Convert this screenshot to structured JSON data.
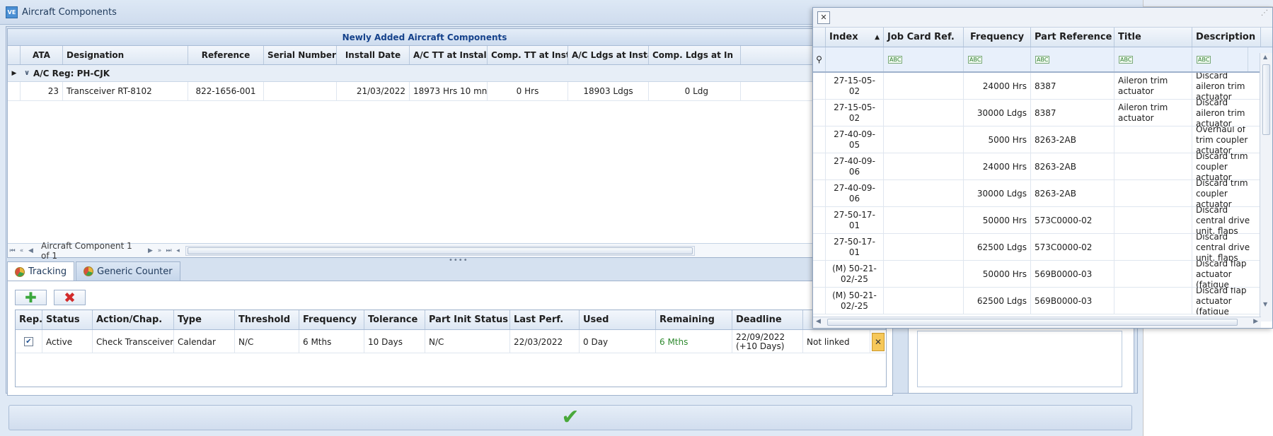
{
  "window": {
    "title": "Aircraft Components",
    "icon": "app-logo-icon"
  },
  "top_grid": {
    "band_title": "Newly Added Aircraft Components",
    "columns": [
      "ATA",
      "Designation",
      "Reference",
      "Serial Number",
      "Install Date",
      "A/C TT at Install",
      "Comp. TT at Install",
      "A/C Ldgs at Install",
      "Comp. Ldgs at In"
    ],
    "group_label": "A/C Reg: PH-CJK",
    "rows": [
      {
        "ata": "23",
        "designation": "Transceiver RT-8102",
        "reference": "822-1656-001",
        "serial": "",
        "install_date": "21/03/2022",
        "ac_tt": "18973 Hrs 10 mn",
        "comp_tt": "0 Hrs",
        "ac_ldgs": "18903 Ldgs",
        "comp_ldgs": "0 Ldg"
      }
    ],
    "nav_text": "Aircraft Component 1 of 1"
  },
  "tabs": [
    {
      "label": "Tracking",
      "icon": "pie-chart-icon",
      "active": true
    },
    {
      "label": "Generic Counter",
      "icon": "pie-chart-icon",
      "active": false
    }
  ],
  "tracking": {
    "columns": [
      "Rep.",
      "Status",
      "Action/Chap.",
      "Type",
      "Threshold",
      "Frequency",
      "Tolerance",
      "Part Init Status",
      "Last Perf.",
      "Used",
      "Remaining",
      "Deadline"
    ],
    "rows": [
      {
        "rep": true,
        "status": "Active",
        "action": "Check Transceiver",
        "type": "Calendar",
        "threshold": "N/C",
        "frequency": "6 Mths",
        "tolerance": "10 Days",
        "part_init": "N/C",
        "last_perf": "22/03/2022",
        "used": "0 Day",
        "remaining": "6 Mths",
        "deadline": "22/09/2022 (+10 Days)",
        "link": "Not linked"
      }
    ]
  },
  "colors": {
    "accent": "#15428b",
    "remaining_green": "#2f8a2f",
    "check_green": "#49a83a",
    "delete_red": "#d22b2b"
  },
  "popup": {
    "columns": [
      "Index",
      "Job Card Ref.",
      "Frequency",
      "Part Reference",
      "Title",
      "Description"
    ],
    "rows": [
      {
        "index": "27-15-05-02",
        "job": "",
        "freq": "24000 Hrs",
        "part": "8387",
        "title": "Aileron trim actuator",
        "desc": "Discard aileron trim actuator"
      },
      {
        "index": "27-15-05-02",
        "job": "",
        "freq": "30000 Ldgs",
        "part": "8387",
        "title": "Aileron trim actuator",
        "desc": "Discard aileron trim actuator"
      },
      {
        "index": "27-40-09-05",
        "job": "",
        "freq": "5000 Hrs",
        "part": "8263-2AB",
        "title": "",
        "desc": "Overhaul of trim coupler actuator"
      },
      {
        "index": "27-40-09-06",
        "job": "",
        "freq": "24000 Hrs",
        "part": "8263-2AB",
        "title": "",
        "desc": "Discard trim coupler actuator"
      },
      {
        "index": "27-40-09-06",
        "job": "",
        "freq": "30000 Ldgs",
        "part": "8263-2AB",
        "title": "",
        "desc": "Discard trim coupler actuator"
      },
      {
        "index": "27-50-17-01",
        "job": "",
        "freq": "50000 Hrs",
        "part": "573C0000-02",
        "title": "",
        "desc": "Discard central drive unit, flaps"
      },
      {
        "index": "27-50-17-01",
        "job": "",
        "freq": "62500 Ldgs",
        "part": "573C0000-02",
        "title": "",
        "desc": "Discard central drive unit, flaps"
      },
      {
        "index": "(M) 50-21-02/-25",
        "job": "",
        "freq": "50000 Hrs",
        "part": "569B0000-03",
        "title": "",
        "desc": "Discard flap actuator (fatigue"
      },
      {
        "index": "(M) 50-21-02/-25",
        "job": "",
        "freq": "62500 Ldgs",
        "part": "569B0000-03",
        "title": "",
        "desc": "Discard flap actuator (fatigue"
      }
    ]
  }
}
